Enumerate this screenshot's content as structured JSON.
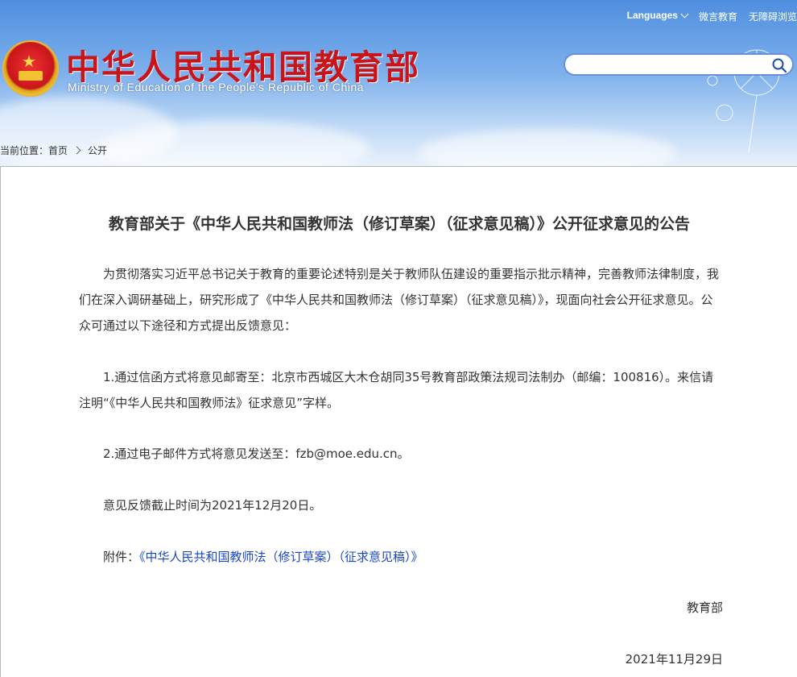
{
  "header": {
    "site_title": "中华人民共和国教育部",
    "site_subtitle": "Ministry of Education of the People's Republic of China",
    "topnav": {
      "languages": "Languages",
      "weibo": "微言教育",
      "accessibility": "无障碍浏览"
    },
    "search": {
      "value": "",
      "placeholder": ""
    }
  },
  "breadcrumb": {
    "prefix": "当前位置：",
    "home": "首页",
    "current": "公开"
  },
  "article": {
    "title": "教育部关于《中华人民共和国教师法（修订草案）（征求意见稿）》公开征求意见的公告",
    "intro": "为贯彻落实习近平总书记关于教育的重要论述特别是关于教师队伍建设的重要指示批示精神，完善教师法律制度，我们在深入调研基础上，研究形成了《中华人民共和国教师法（修订草案）（征求意见稿）》，现面向社会公开征求意见。公众可通过以下途径和方式提出反馈意见：",
    "item1": "1.通过信函方式将意见邮寄至：北京市西城区大木仓胡同35号教育部政策法规司法制办（邮编：100816）。来信请注明“《中华人民共和国教师法》征求意见”字样。",
    "item2": "2.通过电子邮件方式将意见发送至：fzb@moe.edu.cn。",
    "deadline": "意见反馈截止时间为2021年12月20日。",
    "attachment_label": "附件：",
    "attachment_link": "《中华人民共和国教师法（修订草案）（征求意见稿）》",
    "signature": "教育部",
    "date": "2021年11月29日"
  },
  "icons": {
    "emblem": "national-emblem-icon",
    "search": "search-icon",
    "chevron": "chevron-down-icon"
  },
  "colors": {
    "title_red": "#c8151b",
    "link_blue": "#1a47c8",
    "text": "#333333"
  }
}
